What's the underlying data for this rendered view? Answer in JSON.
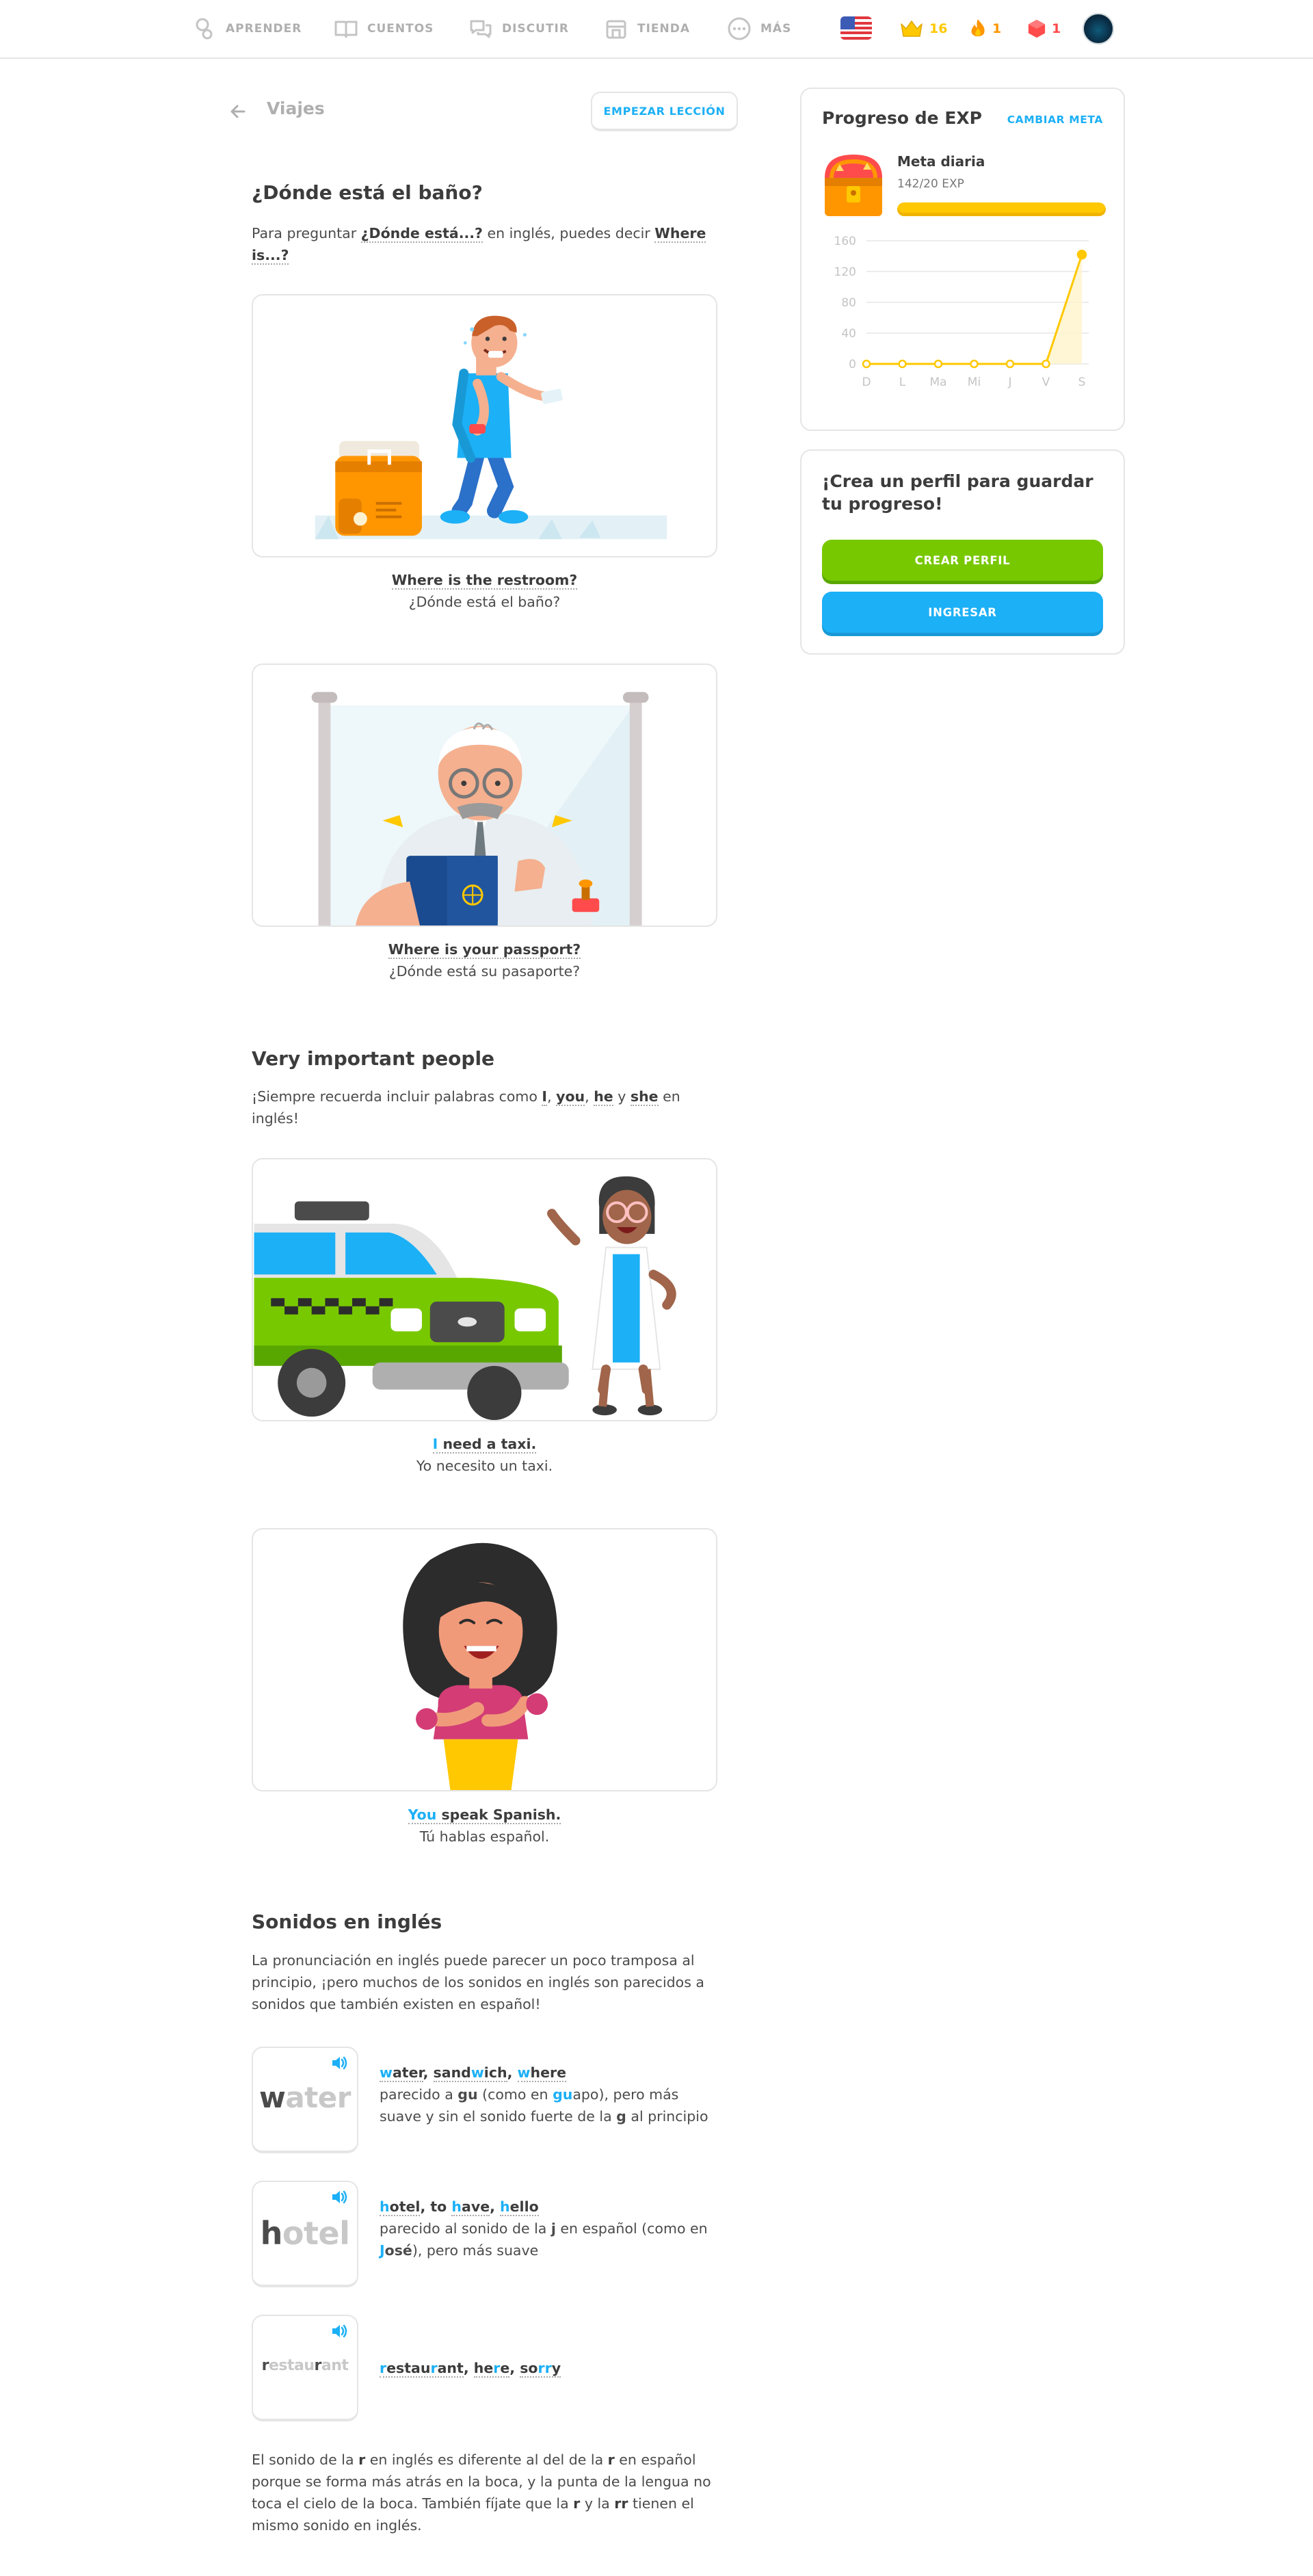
{
  "nav": {
    "items": [
      {
        "label": "APRENDER",
        "icon": "learn-icon"
      },
      {
        "label": "CUENTOS",
        "icon": "book-icon"
      },
      {
        "label": "DISCUTIR",
        "icon": "discuss-icon"
      },
      {
        "label": "TIENDA",
        "icon": "shop-icon"
      },
      {
        "label": "MÁS",
        "icon": "more-icon"
      }
    ],
    "flag": "us-flag-icon",
    "crowns": "16",
    "streak": "1",
    "gems": "1",
    "colors": {
      "crown": "#ffc800",
      "streak": "#ff9600",
      "gems": "#ff4b4b"
    }
  },
  "lesson": {
    "unit_title": "Viajes",
    "start_button": "EMPEZAR LECCIÓN"
  },
  "sections": {
    "bathroom": {
      "title": "¿Dónde está el baño?",
      "intro": {
        "p1": "Para preguntar ",
        "b1": "¿Dónde está...?",
        "p2": " en inglés, puedes decir ",
        "b2": "Where is...?"
      },
      "ex1": {
        "en": "Where is the restroom?",
        "es": "¿Dónde está el baño?"
      },
      "ex2": {
        "en": "Where is your passport?",
        "es": "¿Dónde está su pasaporte?"
      }
    },
    "vip": {
      "title": "Very important people",
      "intro": {
        "p1": "¡Siempre recuerda incluir palabras como ",
        "w1": "I",
        "c1": ", ",
        "w2": "you",
        "c2": ", ",
        "w3": "he",
        "c3": " y ",
        "w4": "she",
        "p2": " en inglés!"
      },
      "ex1": {
        "hl": "I",
        "en": " need a taxi.",
        "es": "Yo necesito un taxi."
      },
      "ex2": {
        "hl": "You",
        "en": " speak Spanish.",
        "es": "Tú hablas español."
      }
    },
    "sounds": {
      "title": "Sonidos en inglés",
      "intro": "La pronunciación en inglés puede parecer un poco tramposa al principio, ¡pero muchos de los sonidos en inglés son parecidos a sonidos que también existen en español!",
      "water": {
        "card_key": "w",
        "card_rest": "ater",
        "w1k": "w",
        "w1r": "ater",
        "s1": ", ",
        "w2a": "sand",
        "w2k": "w",
        "w2r": "ich",
        "s2": ", ",
        "w3k": "w",
        "w3r": "here",
        "d1": "parecido a ",
        "d2": "gu",
        "d3": " (como en ",
        "d4": "gu",
        "d5": "apo), pero más suave y sin el sonido fuerte de la ",
        "d6": "g",
        "d7": " al principio"
      },
      "hotel": {
        "card_key": "h",
        "card_rest": "otel",
        "w1k": "h",
        "w1r": "otel",
        "s1": ", to ",
        "w2k": "h",
        "w2r": "ave",
        "s2": ", ",
        "w3k": "h",
        "w3r": "ello",
        "d1": "parecido al sonido de la ",
        "d2": "j",
        "d3": " en español (como en ",
        "d4": "J",
        "d5": "osé",
        "d6": "), pero más suave"
      },
      "restaurant": {
        "c1": "r",
        "c2": "estau",
        "c3": "r",
        "c4": "ant",
        "w1a": "r",
        "w1b": "estau",
        "w1c": "r",
        "w1d": "ant",
        "s1": ", ",
        "w2a": "he",
        "w2b": "r",
        "w2c": "e",
        "s2": ", ",
        "w3a": "so",
        "w3b": "rr",
        "w3c": "y"
      },
      "outro": {
        "p1": "El sonido de la ",
        "b1": "r",
        "p2": " en inglés es diferente al del de la ",
        "b2": "r",
        "p3": " en español porque se forma más atrás en la boca, y la punta de la lengua no toca el cielo de la boca. También fíjate que la ",
        "b3": "r",
        "p4": " y la ",
        "b4": "rr",
        "p5": " tienen el mismo sonido en inglés."
      }
    }
  },
  "exp_panel": {
    "title": "Progreso de EXP",
    "change_goal": "CAMBIAR META",
    "goal_label": "Meta diaria",
    "goal_exp": "142/20 EXP",
    "goal_progress": 1.0
  },
  "chart_data": {
    "type": "line",
    "categories": [
      "D",
      "L",
      "Ma",
      "Mi",
      "J",
      "V",
      "S"
    ],
    "values": [
      0,
      0,
      0,
      0,
      0,
      0,
      142
    ],
    "y_ticks": [
      "0",
      "40",
      "80",
      "120",
      "160"
    ],
    "ylim": [
      0,
      160
    ],
    "color": "#ffc800",
    "grid": true
  },
  "profile_panel": {
    "title": "¡Crea un perfil para guardar tu progreso!",
    "create_button": "CREAR PERFIL",
    "login_button": "INGRESAR"
  },
  "colors": {
    "accent_blue": "#1cb0f6",
    "green": "#78c800",
    "gold": "#ffc800"
  }
}
